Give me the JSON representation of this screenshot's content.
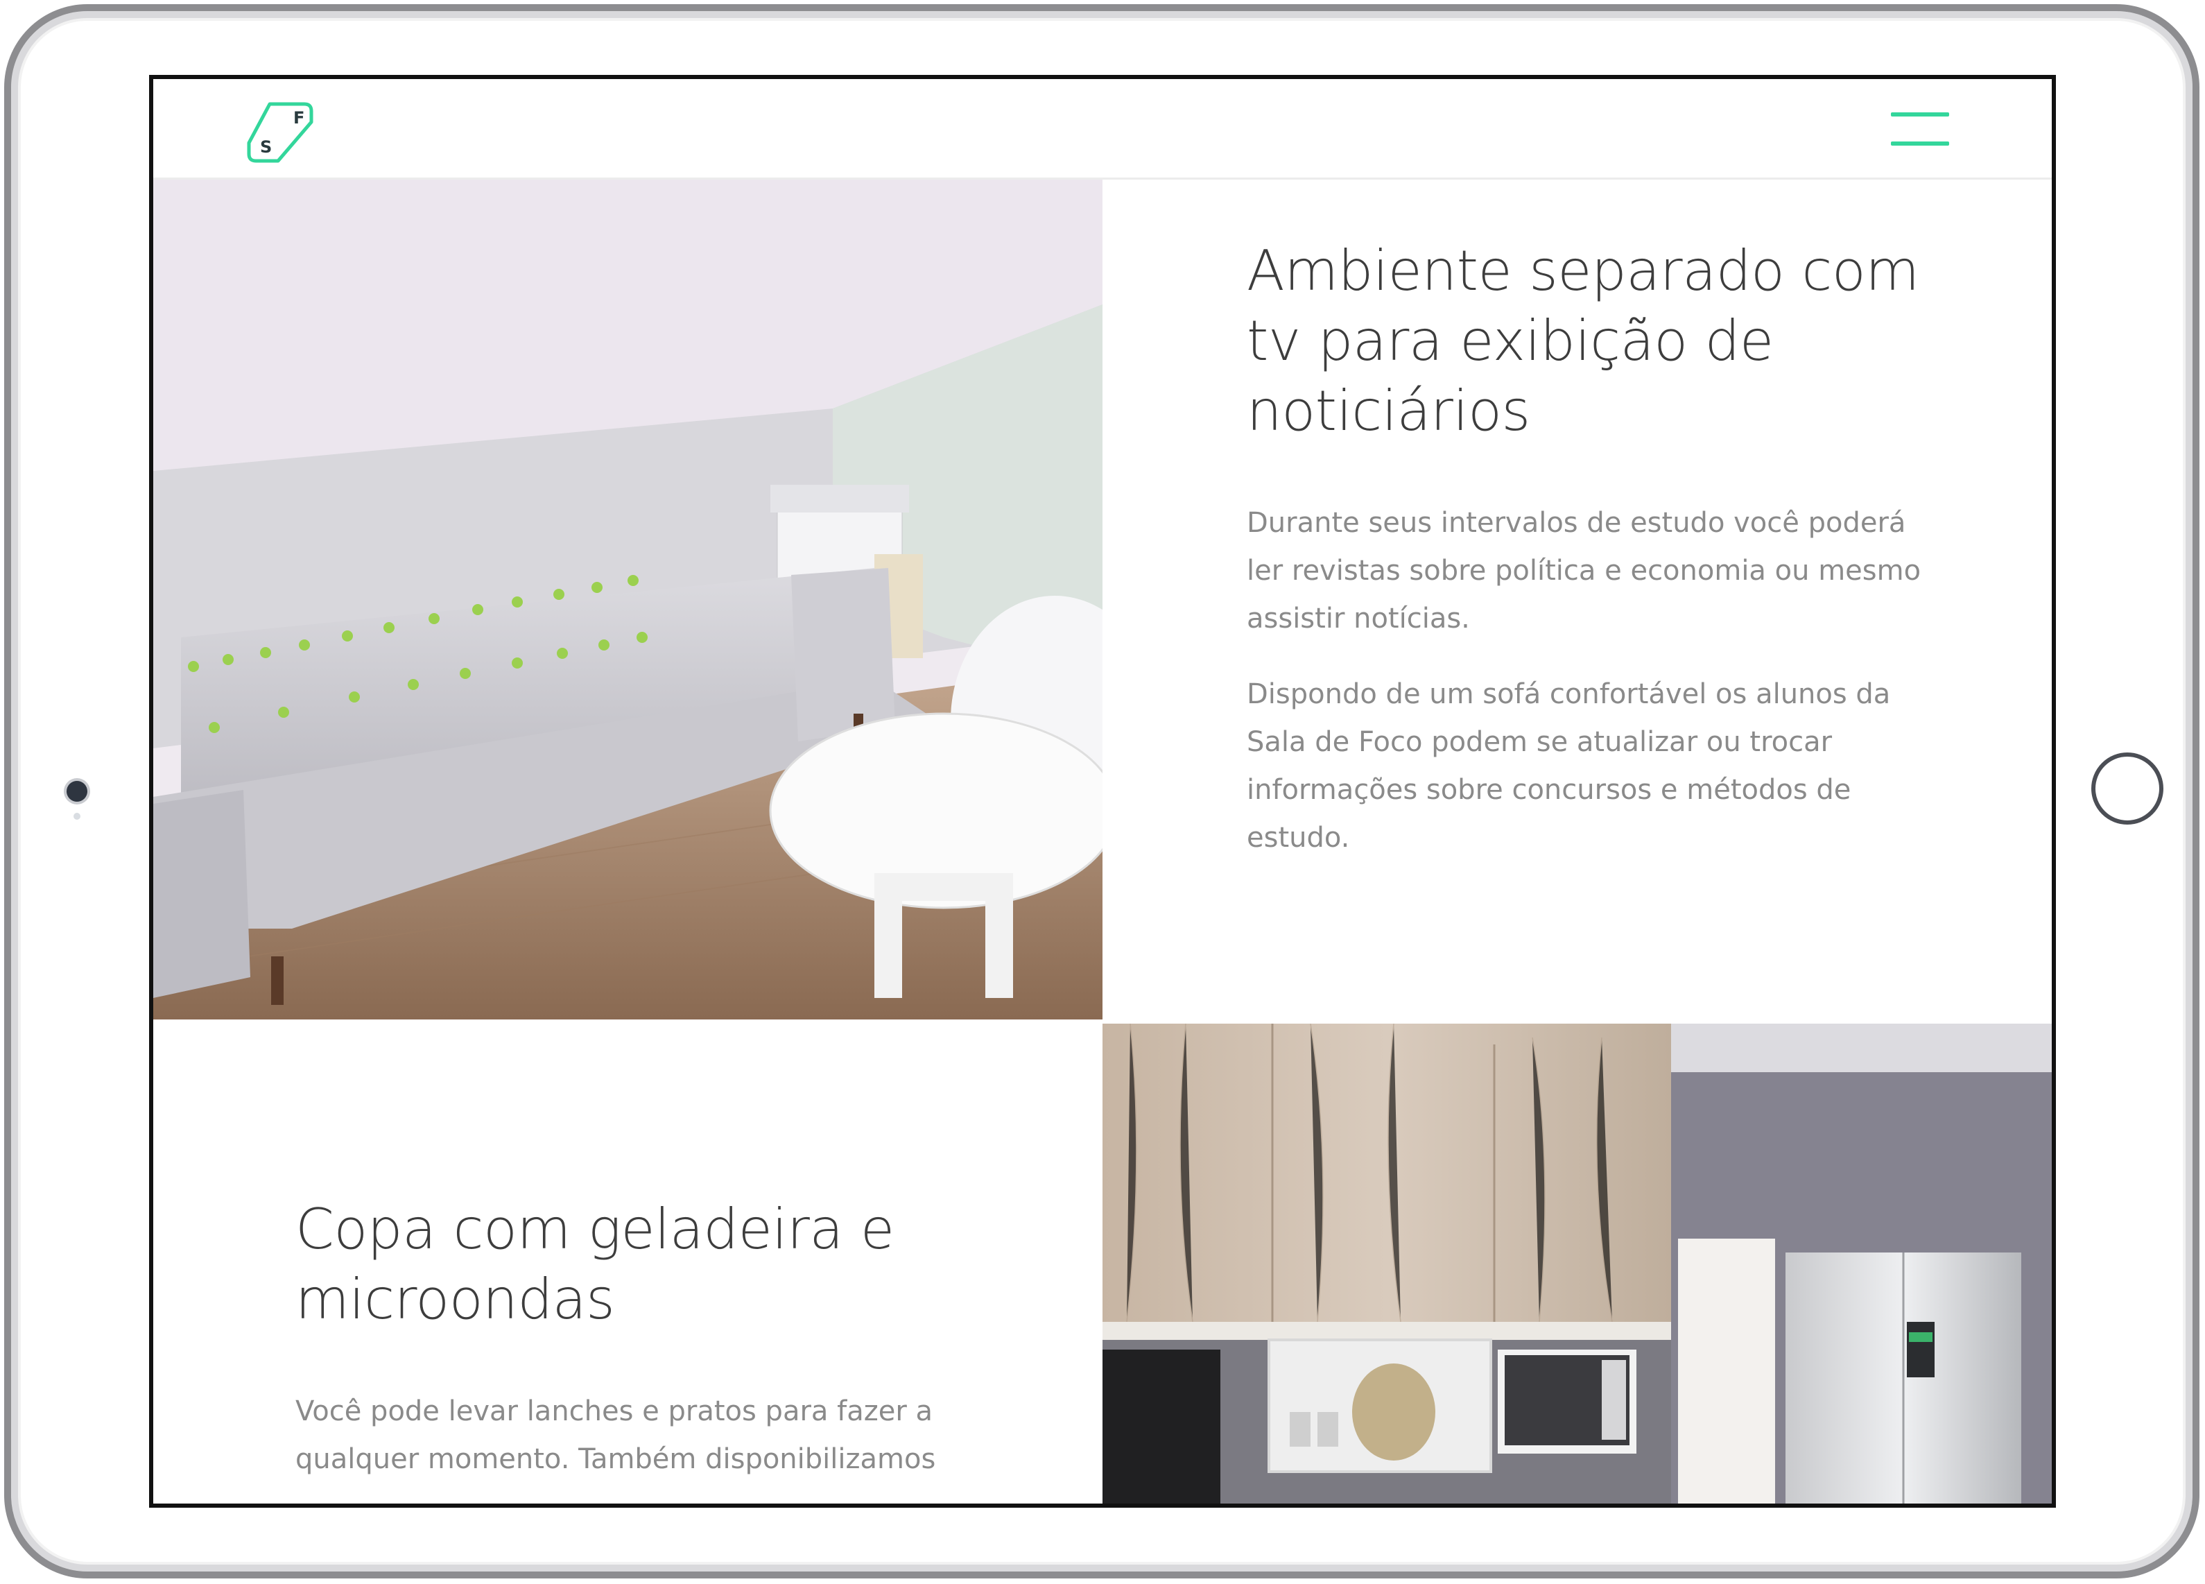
{
  "app": {
    "name": "Sala de Foco"
  },
  "colors": {
    "accent": "#33d69b",
    "heading": "#3d3d3d",
    "body_text": "#8a8a8a"
  },
  "header": {
    "logo": {
      "letter_top": "F",
      "letter_bottom": "S"
    },
    "menu_icon": "hamburger-icon"
  },
  "sections": [
    {
      "title": "Ambiente separado com tv para exibição de noticiários",
      "title_lines": [
        "Ambiente separado com",
        "tv para exibição de",
        "noticiários"
      ],
      "paragraphs": [
        {
          "lines": [
            "Durante seus intervalos de estudo você poderá",
            "ler revistas sobre política e economia ou mesmo",
            "assistir notícias."
          ]
        },
        {
          "lines": [
            "Dispondo de um sofá confortável os alunos da",
            "Sala de Foco podem se atualizar ou trocar",
            "informações sobre concursos e métodos de",
            "estudo."
          ]
        }
      ]
    },
    {
      "title": "Copa com geladeira e microondas",
      "title_lines": [
        "Copa com geladeira e",
        "microondas"
      ],
      "paragraphs": [
        {
          "lines": [
            "Você pode levar lanches e pratos para fazer a",
            "qualquer momento. Também disponibilizamos"
          ]
        }
      ]
    }
  ]
}
